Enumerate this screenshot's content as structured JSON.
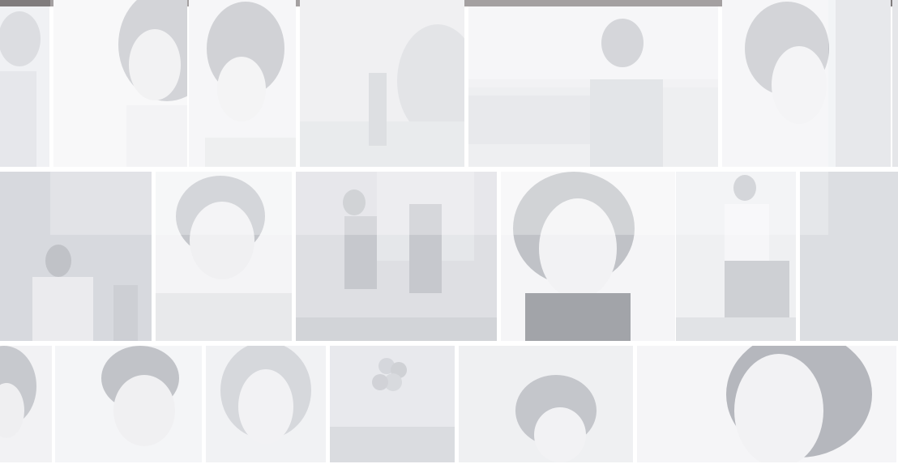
{
  "colors": {
    "topbar": "#3d3738",
    "tile_light": "#e4e5e9",
    "tile_mid": "#cfd1d7",
    "tile_dark": "#b3b6be",
    "hair": "#9a9ca4"
  },
  "gallery": {
    "tiles": [
      {
        "name": "photo-tile",
        "icon": "portrait-icon"
      },
      {
        "name": "photo-tile",
        "icon": "portrait-icon"
      },
      {
        "name": "photo-tile",
        "icon": "portrait-icon"
      },
      {
        "name": "photo-tile",
        "icon": "landscape-icon"
      },
      {
        "name": "photo-tile",
        "icon": "portrait-icon"
      },
      {
        "name": "photo-tile",
        "icon": "portrait-icon"
      },
      {
        "name": "photo-tile",
        "icon": "group-icon"
      },
      {
        "name": "photo-tile",
        "icon": "portrait-icon"
      },
      {
        "name": "photo-tile",
        "icon": "dancer-icon"
      },
      {
        "name": "photo-tile",
        "icon": "portrait-icon"
      },
      {
        "name": "photo-tile",
        "icon": "portrait-icon"
      },
      {
        "name": "photo-tile",
        "icon": "portrait-icon"
      },
      {
        "name": "photo-tile",
        "icon": "portrait-icon"
      },
      {
        "name": "photo-tile",
        "icon": "portrait-icon"
      },
      {
        "name": "photo-tile",
        "icon": "portrait-icon"
      },
      {
        "name": "photo-tile",
        "icon": "balloons-icon"
      },
      {
        "name": "photo-tile",
        "icon": "portrait-icon"
      },
      {
        "name": "photo-tile",
        "icon": "portrait-icon"
      }
    ]
  }
}
